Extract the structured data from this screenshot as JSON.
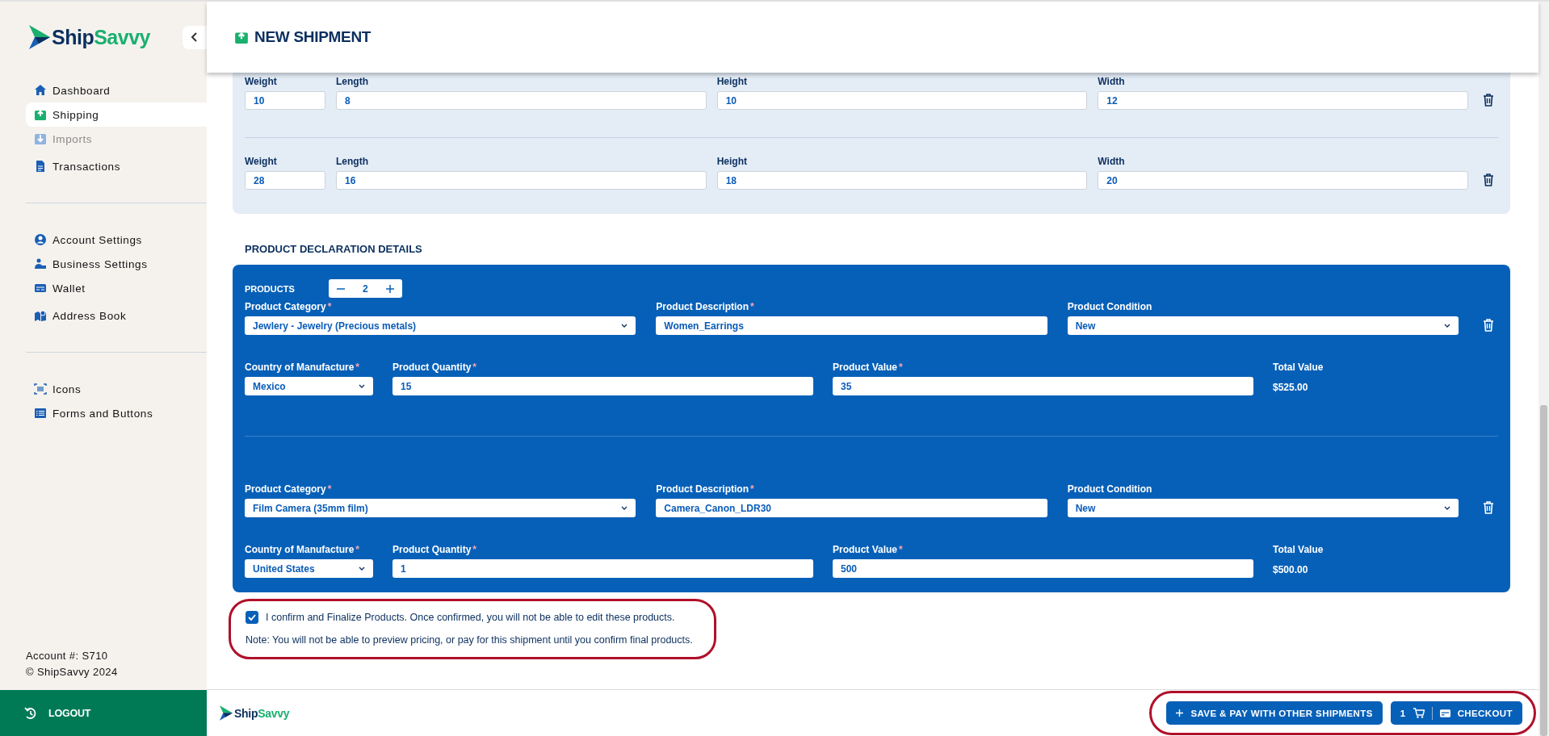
{
  "sidebar": {
    "logo": {
      "part_1": "Ship",
      "part_2": "Savvy"
    },
    "nav_groups": [
      [
        {
          "label": "Dashboard",
          "selected": false,
          "disabled": false
        },
        {
          "label": "Shipping",
          "selected": true,
          "disabled": false
        },
        {
          "label": "Imports",
          "selected": false,
          "disabled": true
        },
        {
          "label": "Transactions",
          "selected": false,
          "disabled": false
        }
      ],
      [
        {
          "label": "Account Settings",
          "selected": false,
          "disabled": false
        },
        {
          "label": "Business Settings",
          "selected": false,
          "disabled": false
        },
        {
          "label": "Wallet",
          "selected": false,
          "disabled": false
        },
        {
          "label": "Address Book",
          "selected": false,
          "disabled": false
        }
      ],
      [
        {
          "label": "Icons",
          "selected": false,
          "disabled": false
        },
        {
          "label": "Forms and Buttons",
          "selected": false,
          "disabled": false
        }
      ]
    ],
    "account": "Account #: S710",
    "copyright": "© ShipSavvy 2024",
    "logout": "LOGOUT"
  },
  "header": {
    "title": "NEW SHIPMENT"
  },
  "packages": [
    {
      "fields": [
        {
          "label": "Weight",
          "value": "10"
        },
        {
          "label": "Length",
          "value": "8"
        },
        {
          "label": "Height",
          "value": "10"
        },
        {
          "label": "Width",
          "value": "12"
        }
      ]
    },
    {
      "fields": [
        {
          "label": "Weight",
          "value": "28"
        },
        {
          "label": "Length",
          "value": "16"
        },
        {
          "label": "Height",
          "value": "18"
        },
        {
          "label": "Width",
          "value": "20"
        }
      ]
    }
  ],
  "products_section": {
    "title": "PRODUCT DECLARATION DETAILS",
    "counter": {
      "label": "PRODUCTS",
      "value": "2"
    },
    "products": [
      {
        "rows": [
          [
            {
              "label": "Product Category",
              "required_mark": "*",
              "kind": "select",
              "value": "Jewlery - Jewelry (Precious metals)"
            },
            {
              "label": "Product Description",
              "required_mark": "*",
              "kind": "input",
              "value": "Women_Earrings"
            },
            {
              "label": "Product Condition",
              "kind": "select",
              "value": "New"
            }
          ],
          [
            {
              "label": "Country of Manufacture",
              "required_mark": "*",
              "kind": "select",
              "value": "Mexico"
            },
            {
              "label": "Product Quantity",
              "required_mark": "*",
              "kind": "input",
              "value": "15"
            },
            {
              "label": "Product Value",
              "required_mark": "*",
              "kind": "input",
              "value": "35"
            }
          ]
        ],
        "total": {
          "label": "Total Value",
          "value": "$525.00"
        }
      },
      {
        "rows": [
          [
            {
              "label": "Product Category",
              "required_mark": "*",
              "kind": "select",
              "value": "Film Camera (35mm film)"
            },
            {
              "label": "Product Description",
              "required_mark": "*",
              "kind": "input",
              "value": "Camera_Canon_LDR30"
            },
            {
              "label": "Product Condition",
              "kind": "select",
              "value": "New"
            }
          ],
          [
            {
              "label": "Country of Manufacture",
              "required_mark": "*",
              "kind": "select",
              "value": "United States"
            },
            {
              "label": "Product Quantity",
              "required_mark": "*",
              "kind": "input",
              "value": "1"
            },
            {
              "label": "Product Value",
              "required_mark": "*",
              "kind": "input",
              "value": "500"
            }
          ]
        ],
        "total": {
          "label": "Total Value",
          "value": "$500.00"
        }
      }
    ],
    "confirm": {
      "checked": true,
      "highlighted": true,
      "label": "I confirm and Finalize Products. Once confirmed, you will not be able to edit these products.",
      "note": "Note: You will not be able to preview pricing, or pay for this shipment until you confirm final products."
    }
  },
  "footer": {
    "logo": {
      "part_1": "Ship",
      "part_2": "Savvy"
    },
    "highlighted": true,
    "save_button": "SAVE & PAY WITH OTHER SHIPMENTS",
    "cart_count": "1",
    "checkout_button": "CHECKOUT"
  }
}
